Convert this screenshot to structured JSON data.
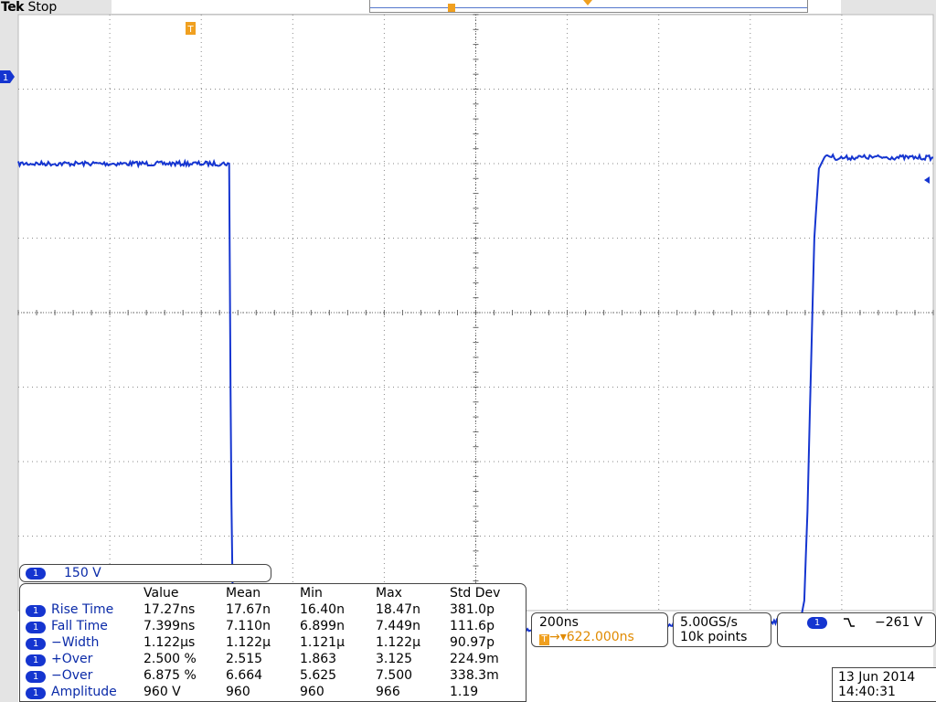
{
  "header": {
    "brand": "Tek",
    "state": "Stop"
  },
  "channel": {
    "badge": "1",
    "scale": "150 V",
    "color": "#1535d0"
  },
  "measurements": {
    "columns": [
      "Value",
      "Mean",
      "Min",
      "Max",
      "Std Dev"
    ],
    "rows": [
      {
        "name": "Rise Time",
        "value": "17.27ns",
        "mean": "17.67n",
        "min": "16.40n",
        "max": "18.47n",
        "std": "381.0p"
      },
      {
        "name": "Fall Time",
        "value": "7.399ns",
        "mean": "7.110n",
        "min": "6.899n",
        "max": "7.449n",
        "std": "111.6p"
      },
      {
        "name": "−Width",
        "value": "1.122µs",
        "mean": "1.122µ",
        "min": "1.121µ",
        "max": "1.122µ",
        "std": "90.97p"
      },
      {
        "name": "+Over",
        "value": "2.500 %",
        "mean": "2.515",
        "min": "1.863",
        "max": "3.125",
        "std": "224.9m"
      },
      {
        "name": "−Over",
        "value": "6.875 %",
        "mean": "6.664",
        "min": "5.625",
        "max": "7.500",
        "std": "338.3m"
      },
      {
        "name": "Amplitude",
        "value": "960 V",
        "mean": "960",
        "min": "960",
        "max": "966",
        "std": "1.19"
      }
    ]
  },
  "timebase": {
    "scale": "200ns",
    "delay": "622.000ns",
    "trigger_icon": "T"
  },
  "acquisition": {
    "rate": "5.00GS/s",
    "points": "10k points"
  },
  "trigger": {
    "badge": "1",
    "edge_icon": "falling-edge-icon",
    "edge_glyph": "⿽",
    "level": "−261 V"
  },
  "datetime": {
    "date": "13 Jun  2014",
    "time": "14:40:31"
  },
  "markers": {
    "trigger_marker": "T",
    "channel_marker": "1"
  },
  "chart_data": {
    "type": "line",
    "title": "",
    "xlabel": "",
    "ylabel": "",
    "x_unit": "ns",
    "y_unit": "V",
    "xlim": [
      -540,
      1460
    ],
    "ylim": [
      -900,
      300
    ],
    "grid": true,
    "series": [
      {
        "x": [
          -540,
          -400,
          -200,
          -79,
          -78,
          -76,
          -74,
          -72,
          -70,
          -66,
          -60,
          -50,
          -40,
          0,
          200,
          400,
          600,
          800,
          1000,
          1100,
          1170,
          1178,
          1185,
          1193,
          1200,
          1210,
          1225,
          1250,
          1300,
          1460
        ],
        "y": [
          0,
          0,
          0,
          0,
          -150,
          -450,
          -680,
          -820,
          -932,
          -990,
          -960,
          -945,
          -950,
          -949,
          -945,
          -942,
          -937,
          -931,
          -924,
          -922,
          -920,
          -880,
          -700,
          -400,
          -150,
          -10,
          18,
          11,
          13,
          12
        ]
      }
    ]
  }
}
